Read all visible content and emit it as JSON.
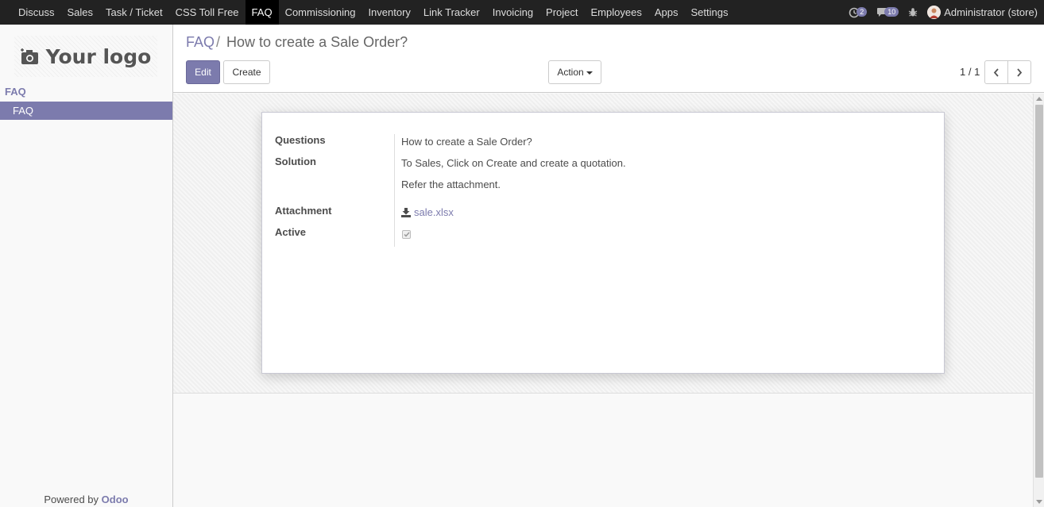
{
  "navbar": {
    "menu": [
      "Discuss",
      "Sales",
      "Task / Ticket",
      "CSS Toll Free",
      "FAQ",
      "Commissioning",
      "Inventory",
      "Link Tracker",
      "Invoicing",
      "Project",
      "Employees",
      "Apps",
      "Settings"
    ],
    "active_menu": "FAQ",
    "activity_count": "2",
    "message_count": "10",
    "user": "Administrator (store)",
    "icons": [
      "activity-icon",
      "chat-icon",
      "bug-icon",
      "user-avatar-icon"
    ]
  },
  "sidebar": {
    "logo_text": "Your logo",
    "heading": "FAQ",
    "items": [
      {
        "label": "FAQ",
        "active": true
      }
    ],
    "powered_by_prefix": "Powered by",
    "powered_by_brand": "Odoo"
  },
  "control": {
    "breadcrumb_parent": "FAQ",
    "breadcrumb_separator": "/",
    "breadcrumb_current": "How to create a Sale Order?",
    "edit_label": "Edit",
    "create_label": "Create",
    "action_label": "Action",
    "pager": "1 / 1"
  },
  "form": {
    "questions_label": "Questions",
    "questions_value": "How to create a Sale Order?",
    "solution_label": "Solution",
    "solution_line1": "To Sales, Click on Create and create a quotation.",
    "solution_line2": "Refer the attachment.",
    "attachment_label": "Attachment",
    "attachment_value": "sale.xlsx",
    "active_label": "Active",
    "active_checked": true
  },
  "colors": {
    "brand": "#7c7bad",
    "navbar": "#222222",
    "brand_odoo": "#7c7bad"
  }
}
